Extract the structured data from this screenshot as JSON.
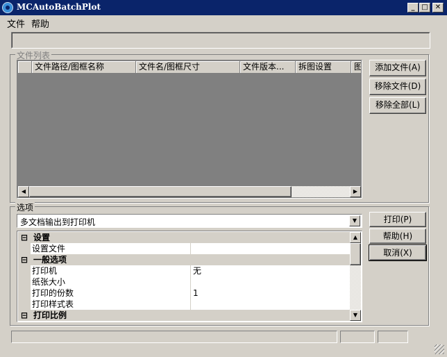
{
  "window": {
    "title": "MCAutoBatchPlot"
  },
  "titlebar_buttons": {
    "minimize": "_",
    "maximize": "□",
    "close": "✕"
  },
  "menu": [
    {
      "label": "文件"
    },
    {
      "label": "帮助"
    }
  ],
  "file_list": {
    "legend": "文件列表",
    "columns": [
      "",
      "文件路径/图框名称",
      "文件名/图框尺寸",
      "文件版本...",
      "拆图设置",
      "图"
    ],
    "buttons": {
      "add": "添加文件(A)",
      "remove": "移除文件(D)",
      "remove_all": "移除全部(L)"
    }
  },
  "options": {
    "legend": "选项",
    "mode_select": "多文档输出到打印机",
    "buttons": {
      "print": "打印(P)",
      "help": "帮助(H)",
      "cancel": "取消(X)"
    },
    "rows": [
      {
        "type": "category",
        "toggle": "⊟",
        "label": "设置"
      },
      {
        "type": "prop",
        "name": "设置文件",
        "value": ""
      },
      {
        "type": "category",
        "toggle": "⊟",
        "label": "一般选项"
      },
      {
        "type": "prop",
        "name": "打印机",
        "value": "无"
      },
      {
        "type": "prop",
        "name": "纸张大小",
        "value": ""
      },
      {
        "type": "prop",
        "name": "打印的份数",
        "value": "1"
      },
      {
        "type": "prop",
        "name": "打印样式表",
        "value": ""
      },
      {
        "type": "category",
        "toggle": "⊟",
        "label": "打印比例"
      }
    ]
  },
  "icons": {
    "app": "app-logo-icon",
    "dropdown": "chevron-down-icon",
    "scroll_left": "arrow-left-icon",
    "scroll_right": "arrow-right-icon",
    "scroll_up": "arrow-up-icon",
    "scroll_down": "arrow-down-icon"
  },
  "colors": {
    "titlebar": "#0a246a",
    "window_bg": "#d4d0c8",
    "list_bg": "#808080"
  }
}
